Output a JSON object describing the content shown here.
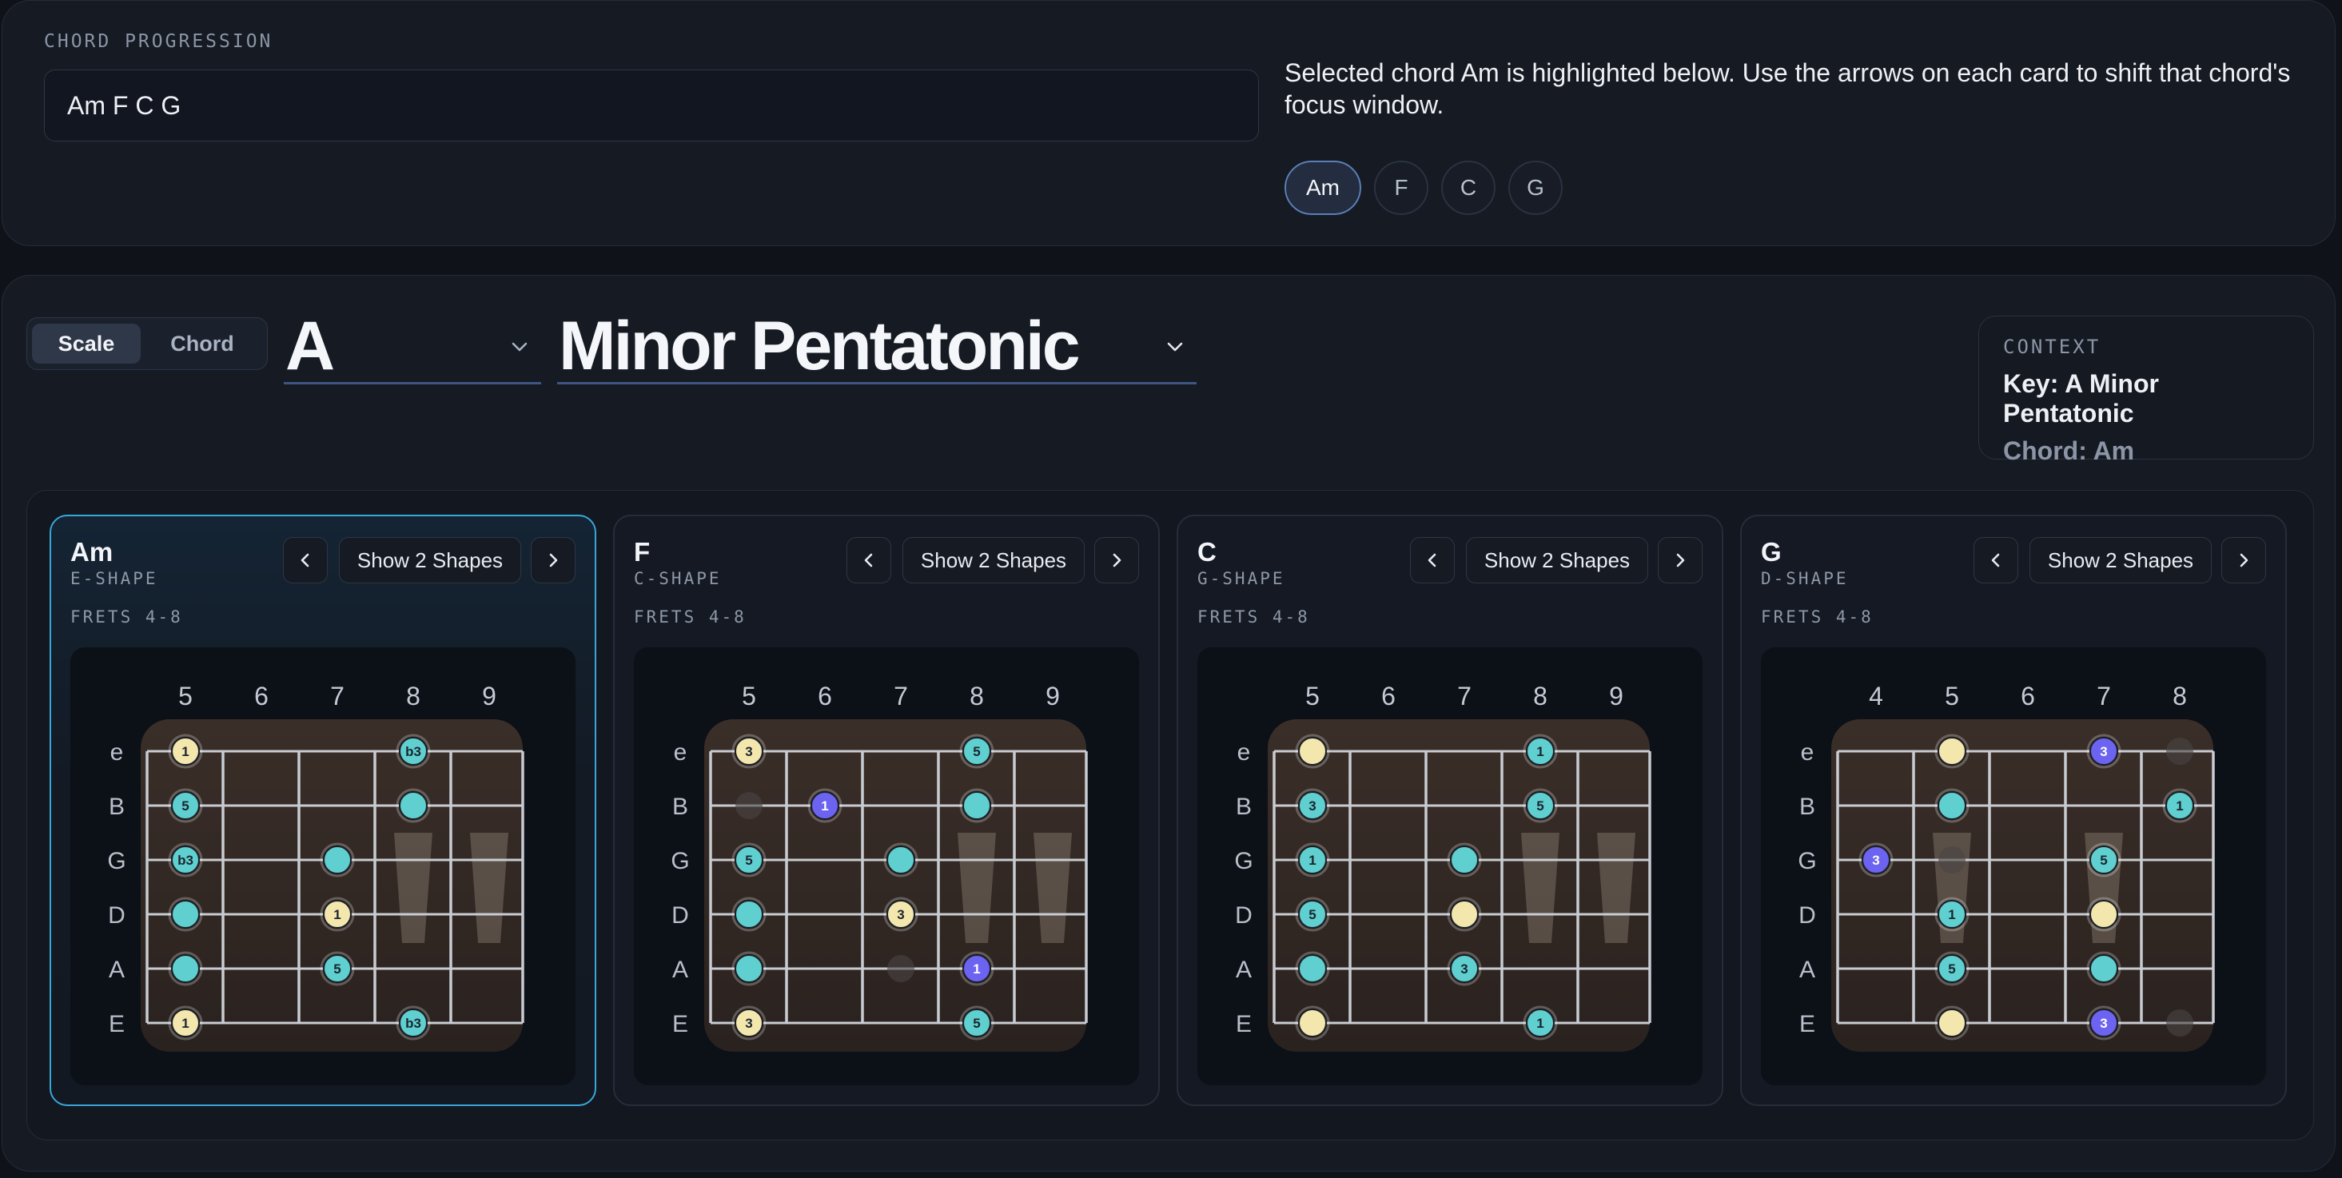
{
  "progression": {
    "label": "CHORD PROGRESSION",
    "value": "Am F C G",
    "help": "Selected chord Am is highlighted below. Use the arrows on each card to shift that chord's focus window.",
    "chips": [
      "Am",
      "F",
      "C",
      "G"
    ],
    "selected": "Am"
  },
  "mode_toggle": {
    "scale": "Scale",
    "chord": "Chord",
    "active": "Scale"
  },
  "key_select": {
    "value": "A",
    "icon": "chevron-down-icon"
  },
  "scale_select": {
    "value": "Minor Pentatonic",
    "icon": "chevron-down-icon"
  },
  "context": {
    "label": "CONTEXT",
    "key": "Key: A Minor Pentatonic",
    "chord": "Chord: Am"
  },
  "colors": {
    "root": "#f4e7ad",
    "scale": "#5fcfcf",
    "accent": "#6c63f0",
    "active_border": "#3aa6d8"
  },
  "cards": [
    {
      "name": "Am",
      "shape": "E-SHAPE",
      "frets": "FRETS 4-8",
      "show_label": "Show 2 Shapes",
      "prev_icon": "chevron-left-icon",
      "next_icon": "chevron-right-icon",
      "fret_numbers": [
        "5",
        "6",
        "7",
        "8",
        "9"
      ],
      "strings": [
        "e",
        "B",
        "G",
        "D",
        "A",
        "E"
      ],
      "inlays": [
        3,
        4
      ],
      "notes": [
        {
          "string": 0,
          "fret": 0,
          "kind": "root",
          "label": "1"
        },
        {
          "string": 0,
          "fret": 3,
          "kind": "scale",
          "label": "b3"
        },
        {
          "string": 1,
          "fret": 0,
          "kind": "scale",
          "label": "5"
        },
        {
          "string": 1,
          "fret": 3,
          "kind": "scale",
          "label": ""
        },
        {
          "string": 2,
          "fret": 0,
          "kind": "scale",
          "label": "b3"
        },
        {
          "string": 2,
          "fret": 2,
          "kind": "scale",
          "label": ""
        },
        {
          "string": 3,
          "fret": 0,
          "kind": "scale",
          "label": ""
        },
        {
          "string": 3,
          "fret": 2,
          "kind": "root",
          "label": "1"
        },
        {
          "string": 4,
          "fret": 0,
          "kind": "scale",
          "label": ""
        },
        {
          "string": 4,
          "fret": 2,
          "kind": "scale",
          "label": "5"
        },
        {
          "string": 5,
          "fret": 0,
          "kind": "root",
          "label": "1"
        },
        {
          "string": 5,
          "fret": 3,
          "kind": "scale",
          "label": "b3"
        }
      ]
    },
    {
      "name": "F",
      "shape": "C-SHAPE",
      "frets": "FRETS 4-8",
      "show_label": "Show 2 Shapes",
      "prev_icon": "chevron-left-icon",
      "next_icon": "chevron-right-icon",
      "fret_numbers": [
        "5",
        "6",
        "7",
        "8",
        "9"
      ],
      "strings": [
        "e",
        "B",
        "G",
        "D",
        "A",
        "E"
      ],
      "inlays": [
        3,
        4
      ],
      "notes": [
        {
          "string": 0,
          "fret": 0,
          "kind": "root",
          "label": "3"
        },
        {
          "string": 0,
          "fret": 3,
          "kind": "scale",
          "label": "5"
        },
        {
          "string": 1,
          "fret": 0,
          "kind": "ghost",
          "label": ""
        },
        {
          "string": 1,
          "fret": 1,
          "kind": "accent",
          "label": "1"
        },
        {
          "string": 1,
          "fret": 3,
          "kind": "scale",
          "label": ""
        },
        {
          "string": 2,
          "fret": 0,
          "kind": "scale",
          "label": "5"
        },
        {
          "string": 2,
          "fret": 2,
          "kind": "scale",
          "label": ""
        },
        {
          "string": 3,
          "fret": 0,
          "kind": "scale",
          "label": ""
        },
        {
          "string": 3,
          "fret": 2,
          "kind": "root",
          "label": "3"
        },
        {
          "string": 4,
          "fret": 0,
          "kind": "scale",
          "label": ""
        },
        {
          "string": 4,
          "fret": 2,
          "kind": "ghost",
          "label": ""
        },
        {
          "string": 4,
          "fret": 3,
          "kind": "accent",
          "label": "1"
        },
        {
          "string": 5,
          "fret": 0,
          "kind": "root",
          "label": "3"
        },
        {
          "string": 5,
          "fret": 3,
          "kind": "scale",
          "label": "5"
        }
      ]
    },
    {
      "name": "C",
      "shape": "G-SHAPE",
      "frets": "FRETS 4-8",
      "show_label": "Show 2 Shapes",
      "prev_icon": "chevron-left-icon",
      "next_icon": "chevron-right-icon",
      "fret_numbers": [
        "5",
        "6",
        "7",
        "8",
        "9"
      ],
      "strings": [
        "e",
        "B",
        "G",
        "D",
        "A",
        "E"
      ],
      "inlays": [
        3,
        4
      ],
      "notes": [
        {
          "string": 0,
          "fret": 0,
          "kind": "root",
          "label": ""
        },
        {
          "string": 0,
          "fret": 3,
          "kind": "scale",
          "label": "1"
        },
        {
          "string": 1,
          "fret": 0,
          "kind": "scale",
          "label": "3"
        },
        {
          "string": 1,
          "fret": 3,
          "kind": "scale",
          "label": "5"
        },
        {
          "string": 2,
          "fret": 0,
          "kind": "scale",
          "label": "1"
        },
        {
          "string": 2,
          "fret": 2,
          "kind": "scale",
          "label": ""
        },
        {
          "string": 3,
          "fret": 0,
          "kind": "scale",
          "label": "5"
        },
        {
          "string": 3,
          "fret": 2,
          "kind": "root",
          "label": ""
        },
        {
          "string": 4,
          "fret": 0,
          "kind": "scale",
          "label": ""
        },
        {
          "string": 4,
          "fret": 2,
          "kind": "scale",
          "label": "3"
        },
        {
          "string": 5,
          "fret": 0,
          "kind": "root",
          "label": ""
        },
        {
          "string": 5,
          "fret": 3,
          "kind": "scale",
          "label": "1"
        }
      ]
    },
    {
      "name": "G",
      "shape": "D-SHAPE",
      "frets": "FRETS 4-8",
      "show_label": "Show 2 Shapes",
      "prev_icon": "chevron-left-icon",
      "next_icon": "chevron-right-icon",
      "fret_numbers": [
        "4",
        "5",
        "6",
        "7",
        "8"
      ],
      "strings": [
        "e",
        "B",
        "G",
        "D",
        "A",
        "E"
      ],
      "inlays": [
        1,
        3
      ],
      "notes": [
        {
          "string": 0,
          "fret": 1,
          "kind": "root",
          "label": ""
        },
        {
          "string": 0,
          "fret": 3,
          "kind": "accent",
          "label": "3"
        },
        {
          "string": 0,
          "fret": 4,
          "kind": "ghost",
          "label": ""
        },
        {
          "string": 1,
          "fret": 1,
          "kind": "scale",
          "label": ""
        },
        {
          "string": 1,
          "fret": 4,
          "kind": "scale",
          "label": "1"
        },
        {
          "string": 2,
          "fret": 0,
          "kind": "accent",
          "label": "3"
        },
        {
          "string": 2,
          "fret": 1,
          "kind": "ghost",
          "label": ""
        },
        {
          "string": 2,
          "fret": 3,
          "kind": "scale",
          "label": "5"
        },
        {
          "string": 3,
          "fret": 1,
          "kind": "scale",
          "label": "1"
        },
        {
          "string": 3,
          "fret": 3,
          "kind": "root",
          "label": ""
        },
        {
          "string": 4,
          "fret": 1,
          "kind": "scale",
          "label": "5"
        },
        {
          "string": 4,
          "fret": 3,
          "kind": "scale",
          "label": ""
        },
        {
          "string": 5,
          "fret": 1,
          "kind": "root",
          "label": ""
        },
        {
          "string": 5,
          "fret": 3,
          "kind": "accent",
          "label": "3"
        },
        {
          "string": 5,
          "fret": 4,
          "kind": "ghost",
          "label": ""
        }
      ]
    }
  ]
}
